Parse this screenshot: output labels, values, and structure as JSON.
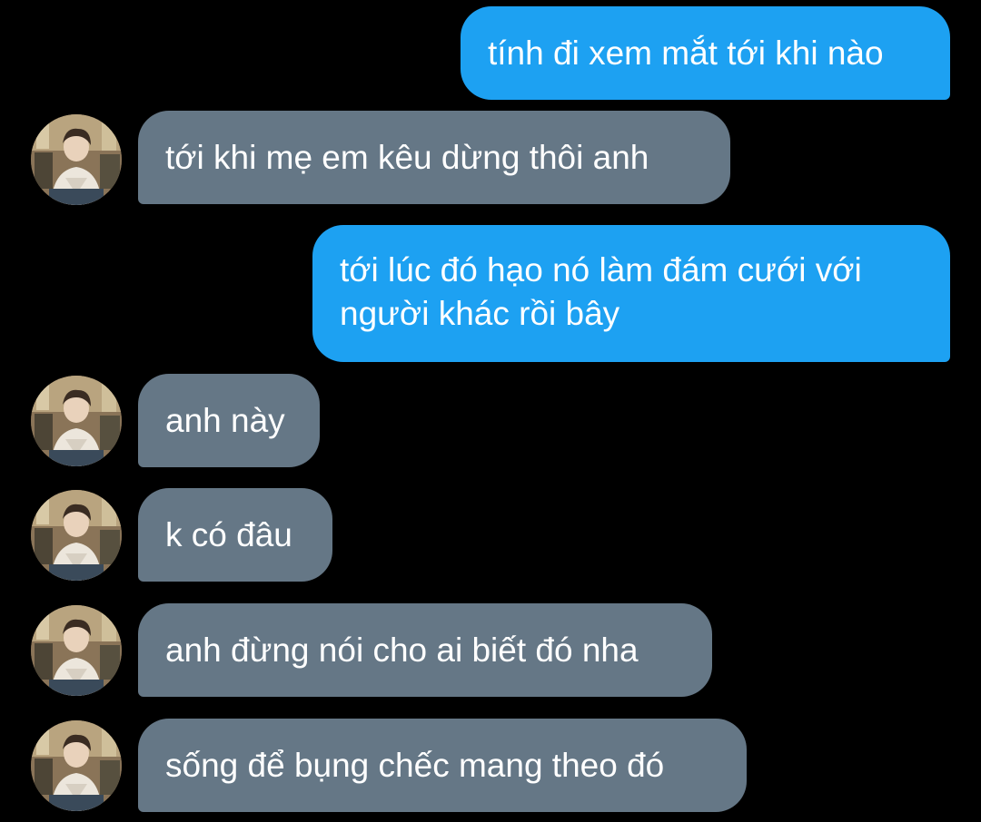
{
  "colors": {
    "background": "#000000",
    "sent_bubble": "#1da1f2",
    "received_bubble": "#657786",
    "text": "#ffffff"
  },
  "contact": {
    "avatar_icon": "profile-photo-avatar"
  },
  "messages": [
    {
      "direction": "sent",
      "text": "tính đi xem mắt tới khi nào"
    },
    {
      "direction": "received",
      "text": "tới khi mẹ em kêu dừng thôi anh"
    },
    {
      "direction": "sent",
      "line1": "tới lúc đó hạo nó làm đám cưới với",
      "line2": "người khác rồi bây"
    },
    {
      "direction": "received",
      "text": "anh này"
    },
    {
      "direction": "received",
      "text": "k có đâu"
    },
    {
      "direction": "received",
      "text": "anh đừng nói cho ai biết đó nha"
    },
    {
      "direction": "received",
      "text": "sống để bụng chếc mang theo đó"
    }
  ]
}
